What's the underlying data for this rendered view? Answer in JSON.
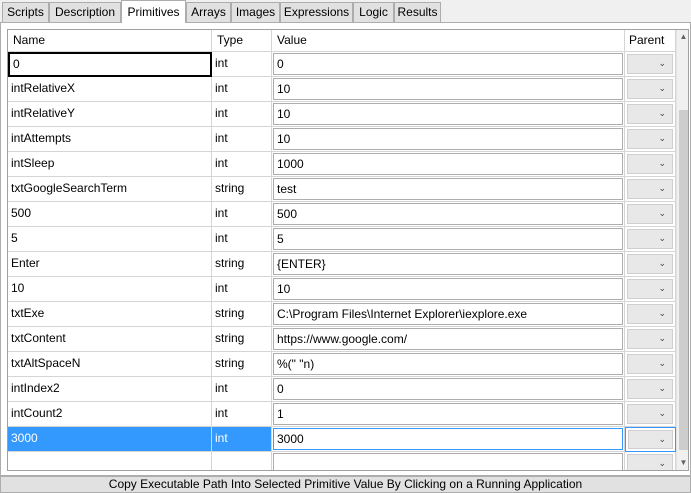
{
  "tabs": [
    {
      "label": "Scripts"
    },
    {
      "label": "Description"
    },
    {
      "label": "Primitives"
    },
    {
      "label": "Arrays"
    },
    {
      "label": "Images"
    },
    {
      "label": "Expressions"
    },
    {
      "label": "Logic"
    },
    {
      "label": "Results"
    }
  ],
  "active_tab": "Primitives",
  "grid": {
    "headers": {
      "name": "Name",
      "type": "Type",
      "value": "Value",
      "parent": "Parent"
    },
    "rows": [
      {
        "name": "0",
        "type": "int",
        "value": "0"
      },
      {
        "name": "intRelativeX",
        "type": "int",
        "value": "10"
      },
      {
        "name": "intRelativeY",
        "type": "int",
        "value": "10"
      },
      {
        "name": "intAttempts",
        "type": "int",
        "value": "10"
      },
      {
        "name": "intSleep",
        "type": "int",
        "value": "1000"
      },
      {
        "name": "txtGoogleSearchTerm",
        "type": "string",
        "value": "test"
      },
      {
        "name": "500",
        "type": "int",
        "value": "500"
      },
      {
        "name": "5",
        "type": "int",
        "value": "5"
      },
      {
        "name": "Enter",
        "type": "string",
        "value": "{ENTER}"
      },
      {
        "name": "10",
        "type": "int",
        "value": "10"
      },
      {
        "name": "txtExe",
        "type": "string",
        "value": "C:\\Program Files\\Internet Explorer\\iexplore.exe"
      },
      {
        "name": "txtContent",
        "type": "string",
        "value": "https://www.google.com/"
      },
      {
        "name": "txtAltSpaceN",
        "type": "string",
        "value": "%(\" \"n)"
      },
      {
        "name": "intIndex2",
        "type": "int",
        "value": "0"
      },
      {
        "name": "intCount2",
        "type": "int",
        "value": "1"
      },
      {
        "name": "3000",
        "type": "int",
        "value": "3000"
      },
      {
        "name": "",
        "type": "",
        "value": ""
      }
    ],
    "selected_row": 15
  },
  "icons": {
    "dropdown": "chevron-down-icon",
    "scroll_up": "arrow-up-icon",
    "scroll_down": "arrow-down-icon"
  },
  "colors": {
    "selection": "#3399ff",
    "tab_bg": "#e1e1e1",
    "panel_bg": "#ffffff"
  },
  "status": "Copy Executable Path Into Selected Primitive Value By Clicking on a Running Application"
}
